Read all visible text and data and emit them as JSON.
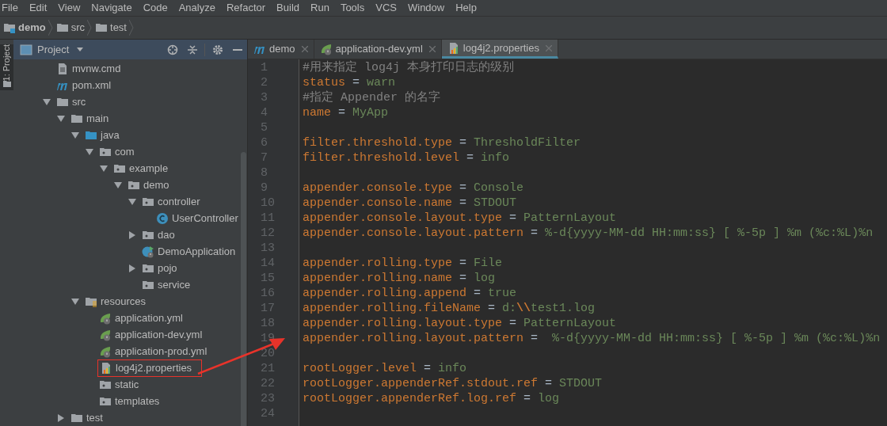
{
  "menu": [
    "File",
    "Edit",
    "View",
    "Navigate",
    "Code",
    "Analyze",
    "Refactor",
    "Build",
    "Run",
    "Tools",
    "VCS",
    "Window",
    "Help"
  ],
  "breadcrumbs": [
    {
      "label": "demo",
      "kind": "module"
    },
    {
      "label": "src",
      "kind": "folder"
    },
    {
      "label": "test",
      "kind": "folder"
    }
  ],
  "tool_strip": {
    "label": "1: Project"
  },
  "project_panel": {
    "title": "Project",
    "tree": [
      {
        "label": "mvnw.cmd",
        "kind": "text"
      },
      {
        "label": "pom.xml",
        "kind": "maven"
      },
      {
        "label": "src",
        "kind": "folder",
        "expanded": true,
        "children": [
          {
            "label": "main",
            "kind": "folder",
            "expanded": true,
            "children": [
              {
                "label": "java",
                "kind": "source",
                "expanded": true,
                "children": [
                  {
                    "label": "com",
                    "kind": "package",
                    "expanded": true,
                    "children": [
                      {
                        "label": "example",
                        "kind": "package",
                        "expanded": true,
                        "children": [
                          {
                            "label": "demo",
                            "kind": "package",
                            "expanded": true,
                            "children": [
                              {
                                "label": "controller",
                                "kind": "package",
                                "expanded": true,
                                "children": [
                                  {
                                    "label": "UserController",
                                    "kind": "class"
                                  }
                                ]
                              },
                              {
                                "label": "dao",
                                "kind": "package",
                                "expanded": false
                              },
                              {
                                "label": "DemoApplication",
                                "kind": "app"
                              },
                              {
                                "label": "pojo",
                                "kind": "package",
                                "expanded": false
                              },
                              {
                                "label": "service",
                                "kind": "package"
                              }
                            ]
                          }
                        ]
                      }
                    ]
                  }
                ]
              },
              {
                "label": "resources",
                "kind": "resources",
                "expanded": true,
                "children": [
                  {
                    "label": "application.yml",
                    "kind": "yml"
                  },
                  {
                    "label": "application-dev.yml",
                    "kind": "yml"
                  },
                  {
                    "label": "application-prod.yml",
                    "kind": "yml"
                  },
                  {
                    "label": "log4j2.properties",
                    "kind": "properties",
                    "highlighted": true
                  },
                  {
                    "label": "static",
                    "kind": "package"
                  },
                  {
                    "label": "templates",
                    "kind": "package"
                  }
                ]
              }
            ]
          },
          {
            "label": "test",
            "kind": "folder",
            "expanded": false
          }
        ]
      }
    ]
  },
  "tabs": [
    {
      "label": "demo",
      "kind": "maven",
      "selected": false
    },
    {
      "label": "application-dev.yml",
      "kind": "yml",
      "selected": false
    },
    {
      "label": "log4j2.properties",
      "kind": "properties",
      "selected": true
    }
  ],
  "editor": {
    "lines": [
      {
        "number": "1",
        "tokens": [
          {
            "kind": "comment",
            "text": "#用来指定 log4j 本身打印日志的级别"
          }
        ]
      },
      {
        "number": "2",
        "tokens": [
          {
            "kind": "key",
            "text": "status"
          },
          {
            "kind": "op",
            "text": " = "
          },
          {
            "kind": "value",
            "text": "warn"
          }
        ]
      },
      {
        "number": "3",
        "tokens": [
          {
            "kind": "comment",
            "text": "#指定 Appender 的名字"
          }
        ]
      },
      {
        "number": "4",
        "tokens": [
          {
            "kind": "key",
            "text": "name"
          },
          {
            "kind": "op",
            "text": " = "
          },
          {
            "kind": "value",
            "text": "MyApp"
          }
        ]
      },
      {
        "number": "5"
      },
      {
        "number": "6",
        "tokens": [
          {
            "kind": "key",
            "text": "filter.threshold.type"
          },
          {
            "kind": "op",
            "text": " = "
          },
          {
            "kind": "value",
            "text": "ThresholdFilter"
          }
        ]
      },
      {
        "number": "7",
        "tokens": [
          {
            "kind": "key",
            "text": "filter.threshold.level"
          },
          {
            "kind": "op",
            "text": " = "
          },
          {
            "kind": "value",
            "text": "info"
          }
        ]
      },
      {
        "number": "8"
      },
      {
        "number": "9",
        "tokens": [
          {
            "kind": "key",
            "text": "appender.console.type"
          },
          {
            "kind": "op",
            "text": " = "
          },
          {
            "kind": "value",
            "text": "Console"
          }
        ]
      },
      {
        "number": "10",
        "tokens": [
          {
            "kind": "key",
            "text": "appender.console.name"
          },
          {
            "kind": "op",
            "text": " = "
          },
          {
            "kind": "value",
            "text": "STDOUT"
          }
        ]
      },
      {
        "number": "11",
        "tokens": [
          {
            "kind": "key",
            "text": "appender.console.layout.type"
          },
          {
            "kind": "op",
            "text": " = "
          },
          {
            "kind": "value",
            "text": "PatternLayout"
          }
        ]
      },
      {
        "number": "12",
        "tokens": [
          {
            "kind": "key",
            "text": "appender.console.layout.pattern"
          },
          {
            "kind": "op",
            "text": " = "
          },
          {
            "kind": "value",
            "text": "%-d{yyyy-MM-dd HH:mm:ss} [ %-5p ] %m (%c:%L)%n"
          }
        ]
      },
      {
        "number": "13"
      },
      {
        "number": "14",
        "tokens": [
          {
            "kind": "key",
            "text": "appender.rolling.type"
          },
          {
            "kind": "op",
            "text": " = "
          },
          {
            "kind": "value",
            "text": "File"
          }
        ]
      },
      {
        "number": "15",
        "tokens": [
          {
            "kind": "key",
            "text": "appender.rolling.name"
          },
          {
            "kind": "op",
            "text": " = "
          },
          {
            "kind": "value",
            "text": "log"
          }
        ]
      },
      {
        "number": "16",
        "tokens": [
          {
            "kind": "key",
            "text": "appender.rolling.append"
          },
          {
            "kind": "op",
            "text": " = "
          },
          {
            "kind": "value",
            "text": "true"
          }
        ]
      },
      {
        "number": "17",
        "tokens": [
          {
            "kind": "key",
            "text": "appender.rolling.fileName"
          },
          {
            "kind": "op",
            "text": " = "
          },
          {
            "kind": "value",
            "text": "d:"
          },
          {
            "kind": "escape",
            "text": "\\\\"
          },
          {
            "kind": "value",
            "text": "test1.log"
          }
        ]
      },
      {
        "number": "18",
        "tokens": [
          {
            "kind": "key",
            "text": "appender.rolling.layout.type"
          },
          {
            "kind": "op",
            "text": " = "
          },
          {
            "kind": "value",
            "text": "PatternLayout"
          }
        ]
      },
      {
        "number": "19",
        "tokens": [
          {
            "kind": "key",
            "text": "appender.rolling.layout.pattern"
          },
          {
            "kind": "op",
            "text": " =  "
          },
          {
            "kind": "value",
            "text": "%-d{yyyy-MM-dd HH:mm:ss} [ %-5p ] %m (%c:%L)%n"
          }
        ]
      },
      {
        "number": "20"
      },
      {
        "number": "21",
        "tokens": [
          {
            "kind": "key",
            "text": "rootLogger.level"
          },
          {
            "kind": "op",
            "text": " = "
          },
          {
            "kind": "value",
            "text": "info"
          }
        ]
      },
      {
        "number": "22",
        "tokens": [
          {
            "kind": "key",
            "text": "rootLogger.appenderRef.stdout.ref"
          },
          {
            "kind": "op",
            "text": " = "
          },
          {
            "kind": "value",
            "text": "STDOUT"
          }
        ]
      },
      {
        "number": "23",
        "tokens": [
          {
            "kind": "key",
            "text": "rootLogger.appenderRef.log.ref"
          },
          {
            "kind": "op",
            "text": " = "
          },
          {
            "kind": "value",
            "text": "log"
          }
        ]
      },
      {
        "number": "24"
      }
    ]
  }
}
